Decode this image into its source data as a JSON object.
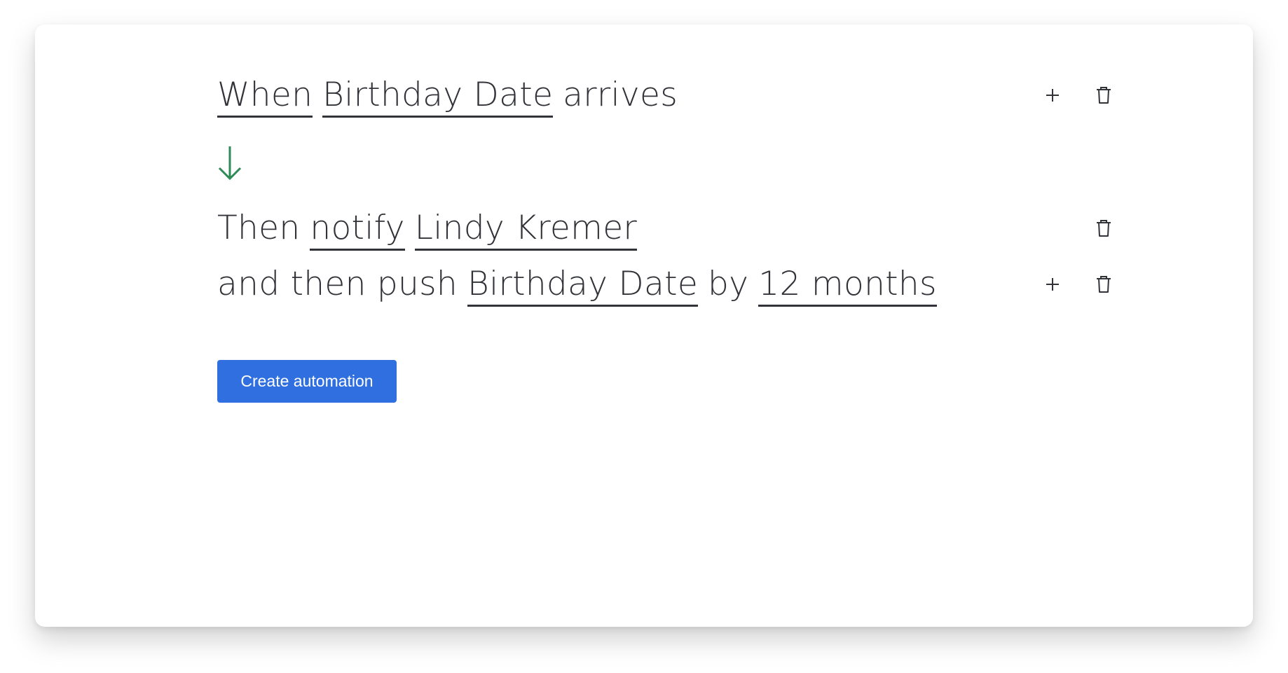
{
  "trigger": {
    "prefix": "When",
    "field": "Birthday Date",
    "suffix": "arrives"
  },
  "action1": {
    "prefix": "Then",
    "verb": "notify",
    "target": "Lindy Kremer"
  },
  "action2": {
    "prefix": "and then push",
    "field": "Birthday Date",
    "by": "by",
    "amount": "12 months"
  },
  "create_button": {
    "label": "Create automation"
  },
  "icons": {
    "add": "plus-icon",
    "delete": "trash-icon",
    "flow": "arrow-down-icon"
  },
  "colors": {
    "primary_button": "#2f6fe0",
    "arrow": "#2e8b57",
    "text": "#323338"
  }
}
